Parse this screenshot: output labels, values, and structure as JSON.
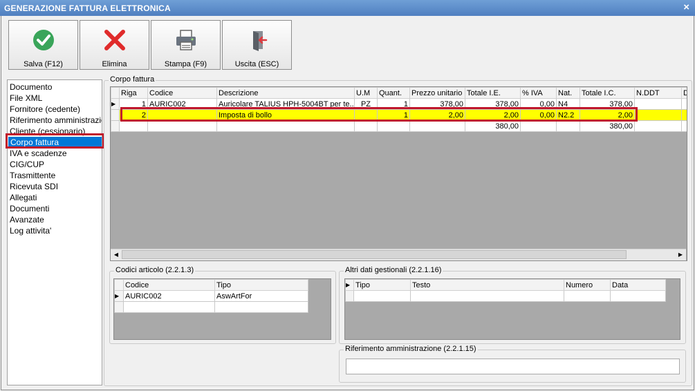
{
  "window": {
    "title": "GENERAZIONE FATTURA ELETTRONICA",
    "close_glyph": "×"
  },
  "toolbar": [
    {
      "label": "Salva (F12)",
      "icon": "check-circle-icon",
      "color": "#3aa55a"
    },
    {
      "label": "Elimina",
      "icon": "red-x-icon",
      "color": "#e02b2b"
    },
    {
      "label": "Stampa (F9)",
      "icon": "printer-icon"
    },
    {
      "label": "Uscita (ESC)",
      "icon": "exit-door-icon"
    }
  ],
  "sidebar": {
    "items": [
      "Documento",
      "File XML",
      "Fornitore (cedente)",
      "Riferimento amministrazione",
      "Cliente (cessionario)",
      "Corpo fattura",
      "IVA e scadenze",
      "CIG/CUP",
      "Trasmittente",
      "Ricevuta SDI",
      "Allegati",
      "Documenti",
      "Avanzate",
      "Log attivita'"
    ],
    "selected": "Corpo fattura"
  },
  "corpo": {
    "title": "Corpo fattura",
    "columns": [
      "Riga",
      "Codice",
      "Descrizione",
      "U.M",
      "Quant.",
      "Prezzo unitario",
      "Totale I.E.",
      "% IVA",
      "Nat.",
      "Totale I.C.",
      "N.DDT",
      "D"
    ],
    "rows": [
      [
        "1",
        "AURIC002",
        "Auricolare TALIUS HPH-5004BT per te...",
        "PZ",
        "1",
        "378,00",
        "378,00",
        "0,00",
        "N4",
        "378,00",
        "",
        ""
      ],
      [
        "2",
        "",
        "Imposta di bollo",
        "",
        "1",
        "2,00",
        "2,00",
        "0,00",
        "N2.2",
        "2,00",
        "",
        ""
      ]
    ],
    "totals": [
      "",
      "",
      "",
      "",
      "",
      "",
      "380,00",
      "",
      "",
      "380,00",
      "",
      ""
    ],
    "highlight_color": "#ffff00"
  },
  "codici": {
    "title": "Codici articolo (2.2.1.3)",
    "columns": [
      "Codice",
      "Tipo"
    ],
    "rows": [
      [
        "AURIC002",
        "AswArtFor"
      ]
    ]
  },
  "altri": {
    "title": "Altri dati gestionali (2.2.1.16)",
    "columns": [
      "Tipo",
      "Testo",
      "Numero",
      "Data"
    ]
  },
  "rifamm": {
    "title": "Riferimento amministrazione (2.2.1.15)",
    "value": ""
  }
}
